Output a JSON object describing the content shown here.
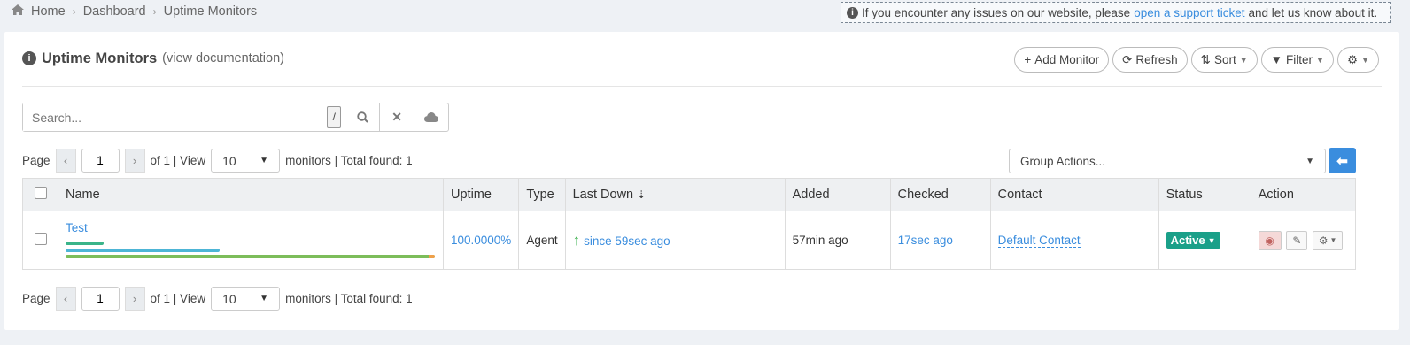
{
  "breadcrumb": {
    "home": "Home",
    "dashboard": "Dashboard",
    "current": "Uptime Monitors"
  },
  "notice": {
    "before": "If you encounter any issues on our website, please",
    "link": "open a support ticket",
    "after": "and let us know about it."
  },
  "panel": {
    "title": "Uptime Monitors",
    "subtitle": "(view documentation)"
  },
  "toolbar": {
    "add": "Add Monitor",
    "refresh": "Refresh",
    "sort": "Sort",
    "filter": "Filter"
  },
  "search": {
    "placeholder": "Search...",
    "shortcut": "/"
  },
  "pager": {
    "page_label": "Page",
    "page": "1",
    "of": "of 1 | View",
    "view": "10",
    "total": "monitors | Total found: 1"
  },
  "group_actions": {
    "label": "Group Actions..."
  },
  "table": {
    "headers": {
      "name": "Name",
      "uptime": "Uptime",
      "type": "Type",
      "last_down": "Last Down",
      "added": "Added",
      "checked": "Checked",
      "contact": "Contact",
      "status": "Status",
      "action": "Action"
    },
    "rows": [
      {
        "name": "Test",
        "uptime": "100.0000%",
        "type": "Agent",
        "last_down": "since 59sec ago",
        "added": "57min ago",
        "checked": "17sec ago",
        "contact": "Default Contact",
        "status": "Active"
      }
    ]
  },
  "colors": {
    "accent": "#3a8dde",
    "status_active": "#1aa089",
    "up_arrow": "#3ab04c"
  }
}
